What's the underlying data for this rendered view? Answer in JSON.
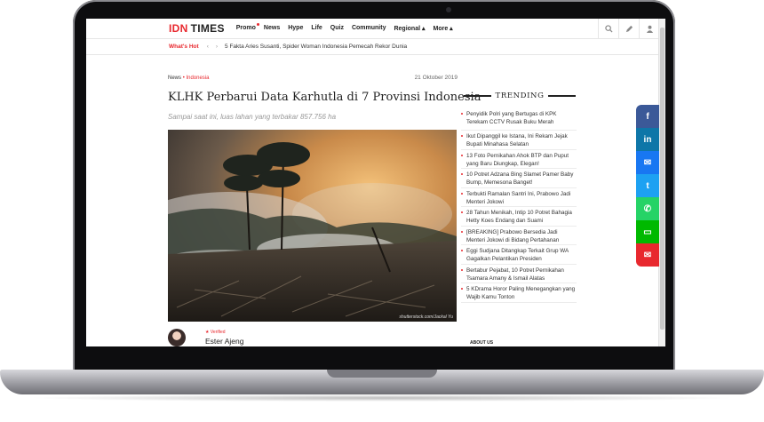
{
  "nav": {
    "logo_part1": "IDN",
    "logo_part2": "TIMES",
    "items": [
      "Promo",
      "News",
      "Hype",
      "Life",
      "Quiz",
      "Community",
      "Regional ▴",
      "More ▴"
    ]
  },
  "hot": {
    "label": "What's Hot",
    "prev": "‹",
    "next": "›",
    "headline": "5 Fakta Aries Susanti, Spider Woman Indonesia Pemecah Rekor Dunia"
  },
  "article": {
    "breadcrumb_section": "News",
    "breadcrumb_sub": "• Indonesia",
    "date": "21 Oktober 2019",
    "title": "KLHK Perbarui Data Karhutla di 7 Provinsi Indonesia",
    "subtitle": "Sampai saat ini, luas lahan yang terbakar 857.756 ha",
    "image_credit": "shutterstock.com/Jackal Yu",
    "author_badge": "★ Verified",
    "author_name": "Ester Ajeng"
  },
  "trending": {
    "heading": "TRENDING",
    "items": [
      "Penyidik Polri yang Bertugas di KPK Terekam CCTV Rusak Buku Merah",
      "Ikut Dipanggil ke Istana, Ini Rekam Jejak Bupati Minahasa Selatan",
      "13 Foto Pernikahan Ahok BTP dan Puput yang Baru Diungkap, Elegan!",
      "10 Potret Adzana Bing Slamet Pamer Baby Bump, Memesona Banget!",
      "Terbukti Ramalan Santri Ini, Prabowo Jadi Menteri Jokowi",
      "28 Tahun Menikah, Intip 10 Potret Bahagia Hetty Koes Endang dan Suami",
      "[BREAKING] Prabowo Bersedia Jadi Menteri Jokowi di Bidang Pertahanan",
      "Eggi Sudjana Ditangkap Terkait Grup WA Gagalkan Pelantikan Presiden",
      "Bertabur Pejabat, 10 Potret Pernikahan Tsamara Amany & Ismail Alatas",
      "5 KDrama Horor Paling Menegangkan yang Wajib Kamu Tonton"
    ],
    "about_label": "ABOUT US"
  },
  "share": [
    {
      "icon": "facebook-icon",
      "glyph": "f",
      "color": "#3b5998"
    },
    {
      "icon": "linkedin-icon",
      "glyph": "in",
      "color": "#0e76a8"
    },
    {
      "icon": "messenger-icon",
      "glyph": "✉",
      "color": "#1877f2"
    },
    {
      "icon": "twitter-icon",
      "glyph": "t",
      "color": "#1da1f2"
    },
    {
      "icon": "whatsapp-icon",
      "glyph": "✆",
      "color": "#25d366"
    },
    {
      "icon": "line-icon",
      "glyph": "▭",
      "color": "#00b900"
    },
    {
      "icon": "email-icon",
      "glyph": "✉",
      "color": "#e8282e"
    }
  ],
  "colors": {
    "accent": "#e8282e"
  }
}
